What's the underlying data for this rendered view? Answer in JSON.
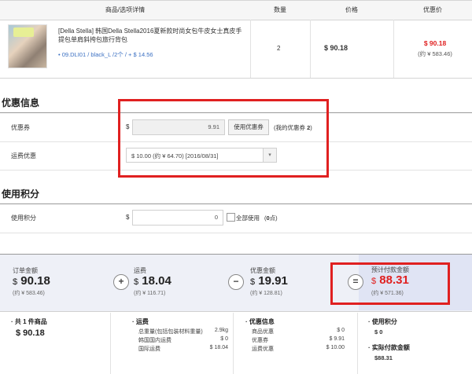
{
  "table": {
    "headers": [
      "商品/选项详情",
      "数量",
      "价格",
      "优惠价"
    ],
    "product": {
      "name": "[Della Stella] 韩国Della Stella2016夏新款时尚女包牛皮女士真皮手提包单肩斜挎包旅行背包",
      "option": "• 09.DLI01 / black_L /2个 / + $ 14.56",
      "quantity": "2",
      "price": "$ 90.18",
      "sale_price": "$ 90.18",
      "sale_price_cny": "(约 ¥ 583.46)"
    }
  },
  "discount": {
    "title": "优惠信息",
    "coupon_label": "优惠券",
    "currency": "$",
    "coupon_value": "9.91",
    "coupon_button": "使用优惠券",
    "my_coupon_text": "(我的优惠券 ",
    "my_coupon_count": "2",
    "my_coupon_close": ")",
    "shipping_label": "运费优惠",
    "shipping_selected": "$ 10.00 (约 ¥ 64.70) [2016/08/31]"
  },
  "points": {
    "title": "使用积分",
    "label": "使用积分",
    "currency": "$",
    "value": "0",
    "use_all": "全部使用",
    "points_prefix": "(",
    "points_value": "0",
    "points_suffix": "点)"
  },
  "summary": {
    "order_label": "订单金额",
    "order_value": "90.18",
    "order_cny": "(约 ¥ 583.46)",
    "ship_label": "运费",
    "ship_value": "18.04",
    "ship_cny": "(约 ¥ 116.71)",
    "disc_label": "优惠金额",
    "disc_value": "19.91",
    "disc_cny": "(约 ¥ 128.81)",
    "pay_label": "预计付款金额",
    "pay_value": "88.31",
    "pay_cny": "(约 ¥ 571.36)",
    "currency": "$",
    "ops": [
      "+",
      "−",
      "="
    ]
  },
  "details": {
    "items_prefix": "· 共 ",
    "items_count": "1",
    "items_suffix": " 件商品",
    "items_total": "$ 90.18",
    "ship_title": "· 运费",
    "ship_rows": [
      {
        "label": "总重量(包括包装材料重量)",
        "value": "2.9kg"
      },
      {
        "label": "韩国国内运费",
        "value": "$ 0"
      },
      {
        "label": "国际运费",
        "value": "$ 18.04"
      }
    ],
    "disc_title": "· 优惠信息",
    "disc_rows": [
      {
        "label": "商品优惠",
        "value": "$ 0"
      },
      {
        "label": "优惠券",
        "value": "$ 9.91"
      },
      {
        "label": "运费优惠",
        "value": "$ 10.00"
      }
    ],
    "points_title": "· 使用积分",
    "points_value": "$ 0",
    "actual_title": "· 实际付款金额",
    "actual_value": "$88.31"
  },
  "colors": {
    "accent_red": "#e02020",
    "link_blue": "#3a6fc2",
    "summary_bg": "#eef0f7"
  }
}
